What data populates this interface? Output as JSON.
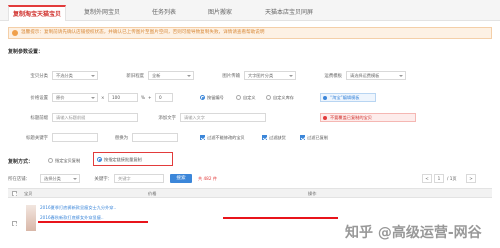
{
  "tabs": [
    {
      "label": "复制淘宝天猫宝贝",
      "active": true
    },
    {
      "label": "复制外网宝贝",
      "active": false
    },
    {
      "label": "任务列表",
      "active": false
    },
    {
      "label": "图片搬家",
      "active": false
    },
    {
      "label": "天猫本店宝贝同屏",
      "active": false
    }
  ],
  "notice": "温馨提示：复制前请先确认店铺授权状态，并确认已上传图片至图片空间，否则可能导致复制失败，详情请查看帮助说明",
  "settings": {
    "title": "复制参数设置：",
    "labels": {
      "category": "宝贝分类",
      "condition": "新旧程度",
      "image_mode": "图片传输",
      "freight": "运费模板",
      "price": "价格设置",
      "title_prefix": "标题前缀",
      "add_text": "添加文字",
      "replace": "标题关键字",
      "replace_with": "替换为"
    },
    "values": {
      "category": "不选分类",
      "condition": "全新",
      "image_mode": "大字图片分类",
      "freight": "请选择运费模板",
      "price_mode": "原价",
      "price_op": "×",
      "price_value": "100",
      "percent": "%",
      "plus": "+",
      "plus_value": "0",
      "title_prefix_placeholder": "请输入标题前缀",
      "add_text_placeholder": "请输入文字"
    },
    "price_options": [
      "按留编号",
      "自定义",
      "自定义库存"
    ],
    "tip_blue": "“淘宝”编辑模板",
    "tip_red": "不要覆盖已复制的宝贝",
    "checkboxes": [
      "过滤不能修改的宝贝",
      "过滤缺货",
      "过滤已复制"
    ]
  },
  "copy_mode": {
    "label": "复制方式：",
    "options": [
      "指定宝贝复制",
      "按指定链接批量复制"
    ],
    "selected_index": 1
  },
  "search": {
    "shop_label": "所在店铺：",
    "shop_value": "选择分类",
    "keyword_label": "关键字：",
    "keyword_placeholder": "关键字",
    "button": "搜索",
    "result_count": "共 482 件",
    "page_prev": "<",
    "page_current": "1",
    "page_total": "/ 1页",
    "page_next": ">"
  },
  "table": {
    "headers": [
      "宝贝",
      "价格",
      "操作"
    ]
  },
  "rows": [
    {
      "title_line1": "2016夏季打底裤新款显瘦女士九分外穿..",
      "title_line2": "2016春秋新款打底裤女外穿显瘦..",
      "price": ""
    }
  ],
  "watermark": "知乎 @高级运营-网谷",
  "colors": {
    "accent": "#3b86d9",
    "brand_red": "#e23b3b",
    "notice_orange": "#f0a04b"
  }
}
